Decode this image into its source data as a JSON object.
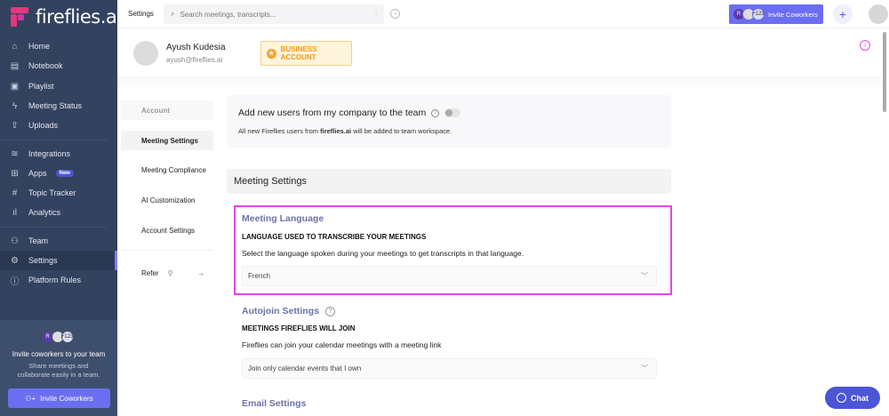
{
  "app": {
    "logo_text": "fireflies.ai",
    "brand_color": "#e8367c",
    "accent": "#6b6ef0"
  },
  "sidebar": {
    "items": [
      {
        "label": "Home",
        "icon": "home-icon",
        "glyph": "⌂"
      },
      {
        "label": "Notebook",
        "icon": "notebook-icon",
        "glyph": "▤"
      },
      {
        "label": "Playlist",
        "icon": "playlist-icon",
        "glyph": "▣"
      },
      {
        "label": "Meeting Status",
        "icon": "lightning-icon",
        "glyph": "ϟ"
      },
      {
        "label": "Uploads",
        "icon": "upload-icon",
        "glyph": "⇪"
      },
      {
        "label": "Integrations",
        "icon": "layers-icon",
        "glyph": "≋"
      },
      {
        "label": "Apps",
        "icon": "apps-grid-icon",
        "glyph": "⊞",
        "badge": "New"
      },
      {
        "label": "Topic Tracker",
        "icon": "hashtag-icon",
        "glyph": "#"
      },
      {
        "label": "Analytics",
        "icon": "bar-chart-icon",
        "glyph": "ıl"
      },
      {
        "label": "Team",
        "icon": "team-icon",
        "glyph": "⚇"
      },
      {
        "label": "Settings",
        "icon": "gear-icon",
        "glyph": "⚙",
        "active": true
      },
      {
        "label": "Platform Rules",
        "icon": "info-icon",
        "glyph": "ⓘ"
      }
    ],
    "invite": {
      "avatar_initial": "R",
      "more_count": "+123",
      "title": "Invite coworkers to your team",
      "subtitle": "Share meetings and collaborate easily in a team.",
      "button": "Invite Coworkers"
    }
  },
  "topbar": {
    "title": "Settings",
    "search_placeholder": "Search meetings, transcripts...",
    "invite_avatar_initial": "R",
    "invite_count": "+123",
    "invite_label": "Invite Coworkers",
    "plus": "+"
  },
  "profile": {
    "name": "Ayush Kudesia",
    "email": "ayush@fireflies.ai",
    "badge": "BUSINESS ACCOUNT"
  },
  "subnav": {
    "header": "Account",
    "items": [
      "Meeting Settings",
      "Meeting Compliance",
      "AI Customization",
      "Account Settings"
    ],
    "selected": "Meeting Settings",
    "refer": "Refer"
  },
  "main": {
    "team_card": {
      "title": "Add new users from my company to the team",
      "toggle_on": false,
      "desc_prefix": "All new Fireflies users from ",
      "domain": "fireflies.ai",
      "desc_suffix": " will be added to team workspace."
    },
    "section_header": "Meeting Settings",
    "language": {
      "title": "Meeting Language",
      "caption": "LANGUAGE USED TO TRANSCRIBE YOUR MEETINGS",
      "desc": "Select the language spoken during your meetings to get transcripts in that language.",
      "value": "French"
    },
    "autojoin": {
      "title": "Autojoin Settings",
      "caption": "MEETINGS FIREFLIES WILL JOIN",
      "desc": "Fireflies can join your calendar meetings with a meeting link",
      "value": "Join only calendar events that I own"
    },
    "email": {
      "title": "Email Settings"
    }
  },
  "chat": {
    "label": "Chat"
  }
}
